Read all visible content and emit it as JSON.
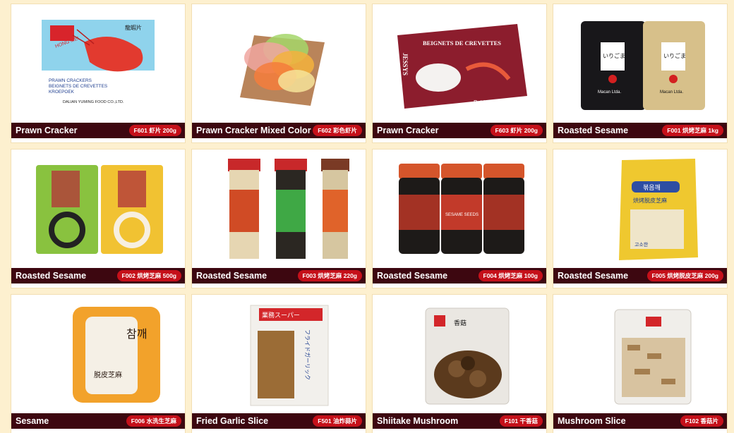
{
  "products": [
    {
      "name": "Prawn Cracker",
      "code": "F601 虾片 200g",
      "image": "prawn-cracker-box-image",
      "package_text": [
        "HONG MEI",
        "PRAWN CRACKERS",
        "BEIGNETS DE CREVETTES",
        "KROEPOEK",
        "DALIAN YUMING FOOD CO.,LTD.",
        "龍蝦片"
      ]
    },
    {
      "name": "Prawn Cracker Mixed Color",
      "code": "F602 彩色虾片",
      "image": "colored-crackers-image"
    },
    {
      "name": "Prawn Cracker",
      "code": "F603 虾片 200g",
      "image": "beignets-box-image",
      "package_text": [
        "BEIGNETS DE CREVETTES",
        "JESSYS",
        "Poids net : 200 g"
      ]
    },
    {
      "name": "Roasted Sesame",
      "code": "F001 烘烤芝麻 1kg",
      "image": "sesame-bags-image",
      "package_text": [
        "いりごま",
        "Macan Ltda."
      ]
    },
    {
      "name": "Roasted Sesame",
      "code": "F002 烘烤芝麻 500g",
      "image": "sesame-pouches-image"
    },
    {
      "name": "Roasted Sesame",
      "code": "F003 烘烤芝麻 220g",
      "image": "sesame-jars-image"
    },
    {
      "name": "Roasted Sesame",
      "code": "F004 烘烤芝麻 100g",
      "image": "black-sesame-jars-image",
      "package_text": [
        "SESAME SEEDS"
      ]
    },
    {
      "name": "Roasted Sesame",
      "code": "F005 烘烤脱皮芝麻 200g",
      "image": "hulled-sesame-bag-image",
      "package_text": [
        "볶음깨",
        "烘烤脱皮芝麻",
        "고소한"
      ]
    },
    {
      "name": "Sesame",
      "code": "F006 水洗生芝麻",
      "image": "sesame-sack-image",
      "package_text": [
        "참깨",
        "脱皮芝麻"
      ]
    },
    {
      "name": "Fried Garlic Slice",
      "code": "F501 油炸蒜片",
      "image": "garlic-bag-image",
      "package_text": [
        "業務スーパー",
        "フライドガーリック"
      ]
    },
    {
      "name": "Shiitake Mushroom",
      "code": "F101 干香菇",
      "image": "shiitake-bag-image",
      "package_text": [
        "香菇"
      ]
    },
    {
      "name": "Mushroom Slice",
      "code": "F102 香菇片",
      "image": "mushroom-slice-bag-image"
    }
  ],
  "colors": {
    "page_bg": "#fdf0cf",
    "caption_bg": "#3d0710",
    "code_badge": "#c5101a"
  }
}
